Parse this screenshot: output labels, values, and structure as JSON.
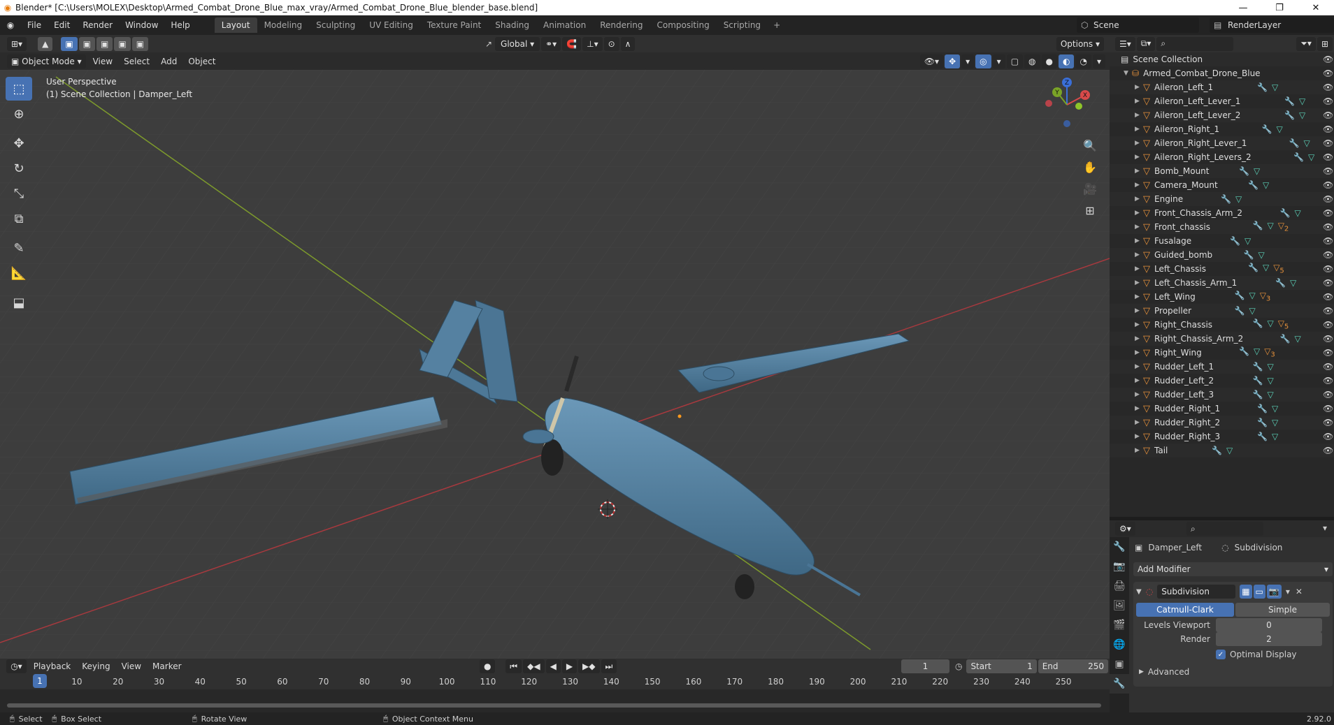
{
  "window": {
    "title": "Blender* [C:\\Users\\MOLEX\\Desktop\\Armed_Combat_Drone_Blue_max_vray/Armed_Combat_Drone_Blue_blender_base.blend]",
    "minimize": "—",
    "maximize": "❐",
    "close": "✕"
  },
  "menus": [
    "File",
    "Edit",
    "Render",
    "Window",
    "Help"
  ],
  "workspaces": [
    "Layout",
    "Modeling",
    "Sculpting",
    "UV Editing",
    "Texture Paint",
    "Shading",
    "Animation",
    "Rendering",
    "Compositing",
    "Scripting"
  ],
  "workspace_add": "+",
  "scene": {
    "name": "Scene",
    "view_layer": "RenderLayer"
  },
  "viewport_header": {
    "transform_orientation": "Global",
    "options": "Options",
    "mode": "Object Mode",
    "menus": [
      "View",
      "Select",
      "Add",
      "Object"
    ]
  },
  "viewport": {
    "perspective_label": "User Perspective",
    "collection_label": "(1) Scene Collection | Damper_Left",
    "gizmo": {
      "x": "X",
      "y": "Y",
      "z": "Z"
    }
  },
  "timeline": {
    "menus": [
      "Playback",
      "Keying",
      "View",
      "Marker"
    ],
    "current_frame": "1",
    "start_label": "Start",
    "start": "1",
    "end_label": "End",
    "end": "250",
    "ticks": [
      "10",
      "20",
      "30",
      "40",
      "50",
      "60",
      "70",
      "80",
      "90",
      "100",
      "110",
      "120",
      "130",
      "140",
      "150",
      "160",
      "170",
      "180",
      "190",
      "200",
      "210",
      "220",
      "230",
      "240",
      "250"
    ],
    "playhead": "1"
  },
  "statusbar": {
    "select": "Select",
    "box_select": "Box Select",
    "rotate_view": "Rotate View",
    "context_menu": "Object Context Menu",
    "version": "2.92.0"
  },
  "outliner": {
    "root": "Scene Collection",
    "collection": "Armed_Combat_Drone_Blue",
    "objects": [
      {
        "name": "Aileron_Left_1",
        "badge": ""
      },
      {
        "name": "Aileron_Left_Lever_1",
        "badge": ""
      },
      {
        "name": "Aileron_Left_Lever_2",
        "badge": ""
      },
      {
        "name": "Aileron_Right_1",
        "badge": ""
      },
      {
        "name": "Aileron_Right_Lever_1",
        "badge": ""
      },
      {
        "name": "Aileron_Right_Levers_2",
        "badge": ""
      },
      {
        "name": "Bomb_Mount",
        "badge": ""
      },
      {
        "name": "Camera_Mount",
        "badge": ""
      },
      {
        "name": "Engine",
        "badge": ""
      },
      {
        "name": "Front_Chassis_Arm_2",
        "badge": ""
      },
      {
        "name": "Front_chassis",
        "badge": "2"
      },
      {
        "name": "Fusalage",
        "badge": ""
      },
      {
        "name": "Guided_bomb",
        "badge": ""
      },
      {
        "name": "Left_Chassis",
        "badge": "5"
      },
      {
        "name": "Left_Chassis_Arm_1",
        "badge": ""
      },
      {
        "name": "Left_Wing",
        "badge": "3"
      },
      {
        "name": "Propeller",
        "badge": ""
      },
      {
        "name": "Right_Chassis",
        "badge": "5"
      },
      {
        "name": "Right_Chassis_Arm_2",
        "badge": ""
      },
      {
        "name": "Right_Wing",
        "badge": "3"
      },
      {
        "name": "Rudder_Left_1",
        "badge": ""
      },
      {
        "name": "Rudder_Left_2",
        "badge": ""
      },
      {
        "name": "Rudder_Left_3",
        "badge": ""
      },
      {
        "name": "Rudder_Right_1",
        "badge": ""
      },
      {
        "name": "Rudder_Right_2",
        "badge": ""
      },
      {
        "name": "Rudder_Right_3",
        "badge": ""
      },
      {
        "name": "Tail",
        "badge": ""
      }
    ]
  },
  "properties": {
    "object": "Damper_Left",
    "modifier_tab": "Subdivision",
    "add_modifier": "Add Modifier",
    "modifier": {
      "name": "Subdivision",
      "type_a": "Catmull-Clark",
      "type_b": "Simple",
      "levels_viewport_label": "Levels Viewport",
      "levels_viewport": "0",
      "render_label": "Render",
      "render": "2",
      "optimal_display": "Optimal Display",
      "advanced": "Advanced"
    }
  },
  "colors": {
    "accent": "#4772b3",
    "object": "#e8923b",
    "mesh": "#5bd1b8",
    "grid": "#3d3d3d",
    "drone": "#4a7595"
  }
}
